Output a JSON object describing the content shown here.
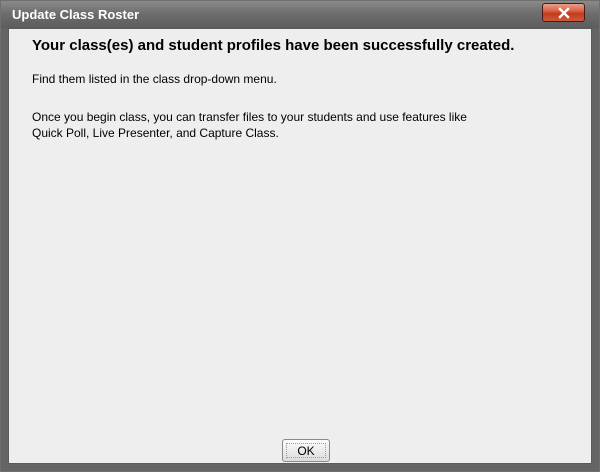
{
  "window": {
    "title": "Update Class Roster"
  },
  "dialog": {
    "headline": "Your class(es) and student profiles have been successfully created.",
    "line1": "Find them listed in the class drop-down menu.",
    "line2": "Once you begin class, you can transfer files to your students and use features like",
    "line3": "Quick Poll, Live Presenter, and Capture Class."
  },
  "buttons": {
    "ok_label": "OK",
    "close_icon": "close-icon"
  },
  "colors": {
    "titlebar": "#6e6e6e",
    "close_button": "#d65a3c",
    "client_background": "#eeeeee"
  }
}
